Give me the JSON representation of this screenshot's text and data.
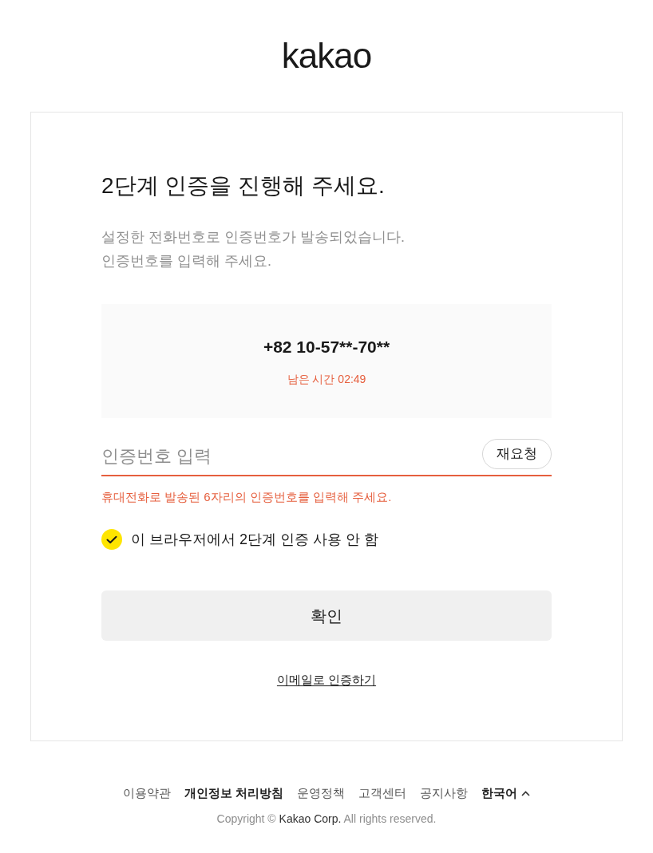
{
  "logo": "kakao",
  "heading": "2단계 인증을 진행해 주세요.",
  "description": [
    "설정한 전화번호로 인증번호가 발송되었습니다.",
    "인증번호를 입력해 주세요."
  ],
  "phone_panel": {
    "number": "+82 10-57**-70**",
    "timer": "남은 시간 02:49"
  },
  "code_field": {
    "placeholder": "인증번호 입력",
    "error": true,
    "resend_button": "재요청"
  },
  "error_message": "휴대전화로 발송된 6자리의 인증번호를 입력해 주세요.",
  "remember": {
    "label": "이 브라우저에서 2단계 인증 사용 안 함",
    "checked": true
  },
  "confirm_button": "확인",
  "email_link": "이메일로 인증하기",
  "footer": {
    "links": [
      {
        "label": "이용약관",
        "emphasized": false,
        "kind": "link"
      },
      {
        "label": "개인정보 처리방침",
        "emphasized": true,
        "kind": "link"
      },
      {
        "label": "운영정책",
        "emphasized": false,
        "kind": "link"
      },
      {
        "label": "고객센터",
        "emphasized": false,
        "kind": "link"
      },
      {
        "label": "공지사항",
        "emphasized": false,
        "kind": "link"
      },
      {
        "label": "한국어",
        "emphasized": true,
        "kind": "language"
      }
    ],
    "copyright": {
      "before": "Copyright ©",
      "company": "Kakao Corp.",
      "after": "All rights reserved."
    }
  }
}
